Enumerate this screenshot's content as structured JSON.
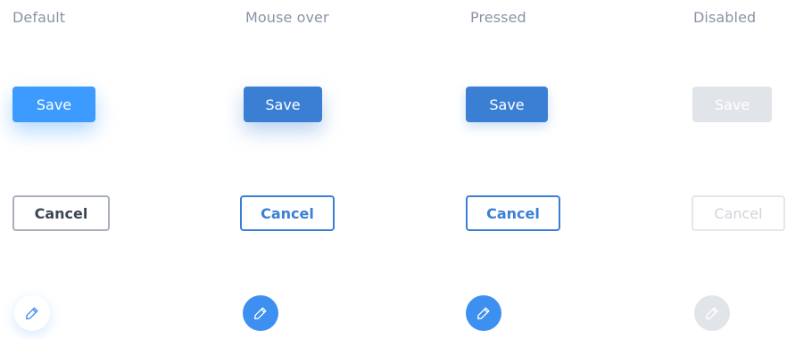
{
  "states": [
    {
      "header": "Default",
      "save_label": "Save",
      "cancel_label": "Cancel",
      "fab_icon": "pencil-icon",
      "colors": {
        "save_bg": "#3d9bff",
        "cancel_border": "#a8afbd",
        "fab_bg": "#ffffff",
        "icon": "#3d8ff0"
      }
    },
    {
      "header": "Mouse over",
      "save_label": "Save",
      "cancel_label": "Cancel",
      "fab_icon": "pencil-icon",
      "colors": {
        "save_bg": "#3a7fd4",
        "cancel_border": "#3a7fd4",
        "fab_bg": "#3d8ff0",
        "icon": "#ffffff"
      }
    },
    {
      "header": "Pressed",
      "save_label": "Save",
      "cancel_label": "Cancel",
      "fab_icon": "pencil-icon",
      "colors": {
        "save_bg": "#3a7fd4",
        "cancel_border": "#3a7fd4",
        "fab_bg": "#3d8ff0",
        "icon": "#ffffff"
      }
    },
    {
      "header": "Disabled",
      "save_label": "Save",
      "cancel_label": "Cancel",
      "fab_icon": "pencil-icon",
      "colors": {
        "save_bg": "#e1e4e8",
        "cancel_border": "#e3e6ea",
        "fab_bg": "#e1e4e8",
        "icon": "#ffffff"
      }
    }
  ]
}
